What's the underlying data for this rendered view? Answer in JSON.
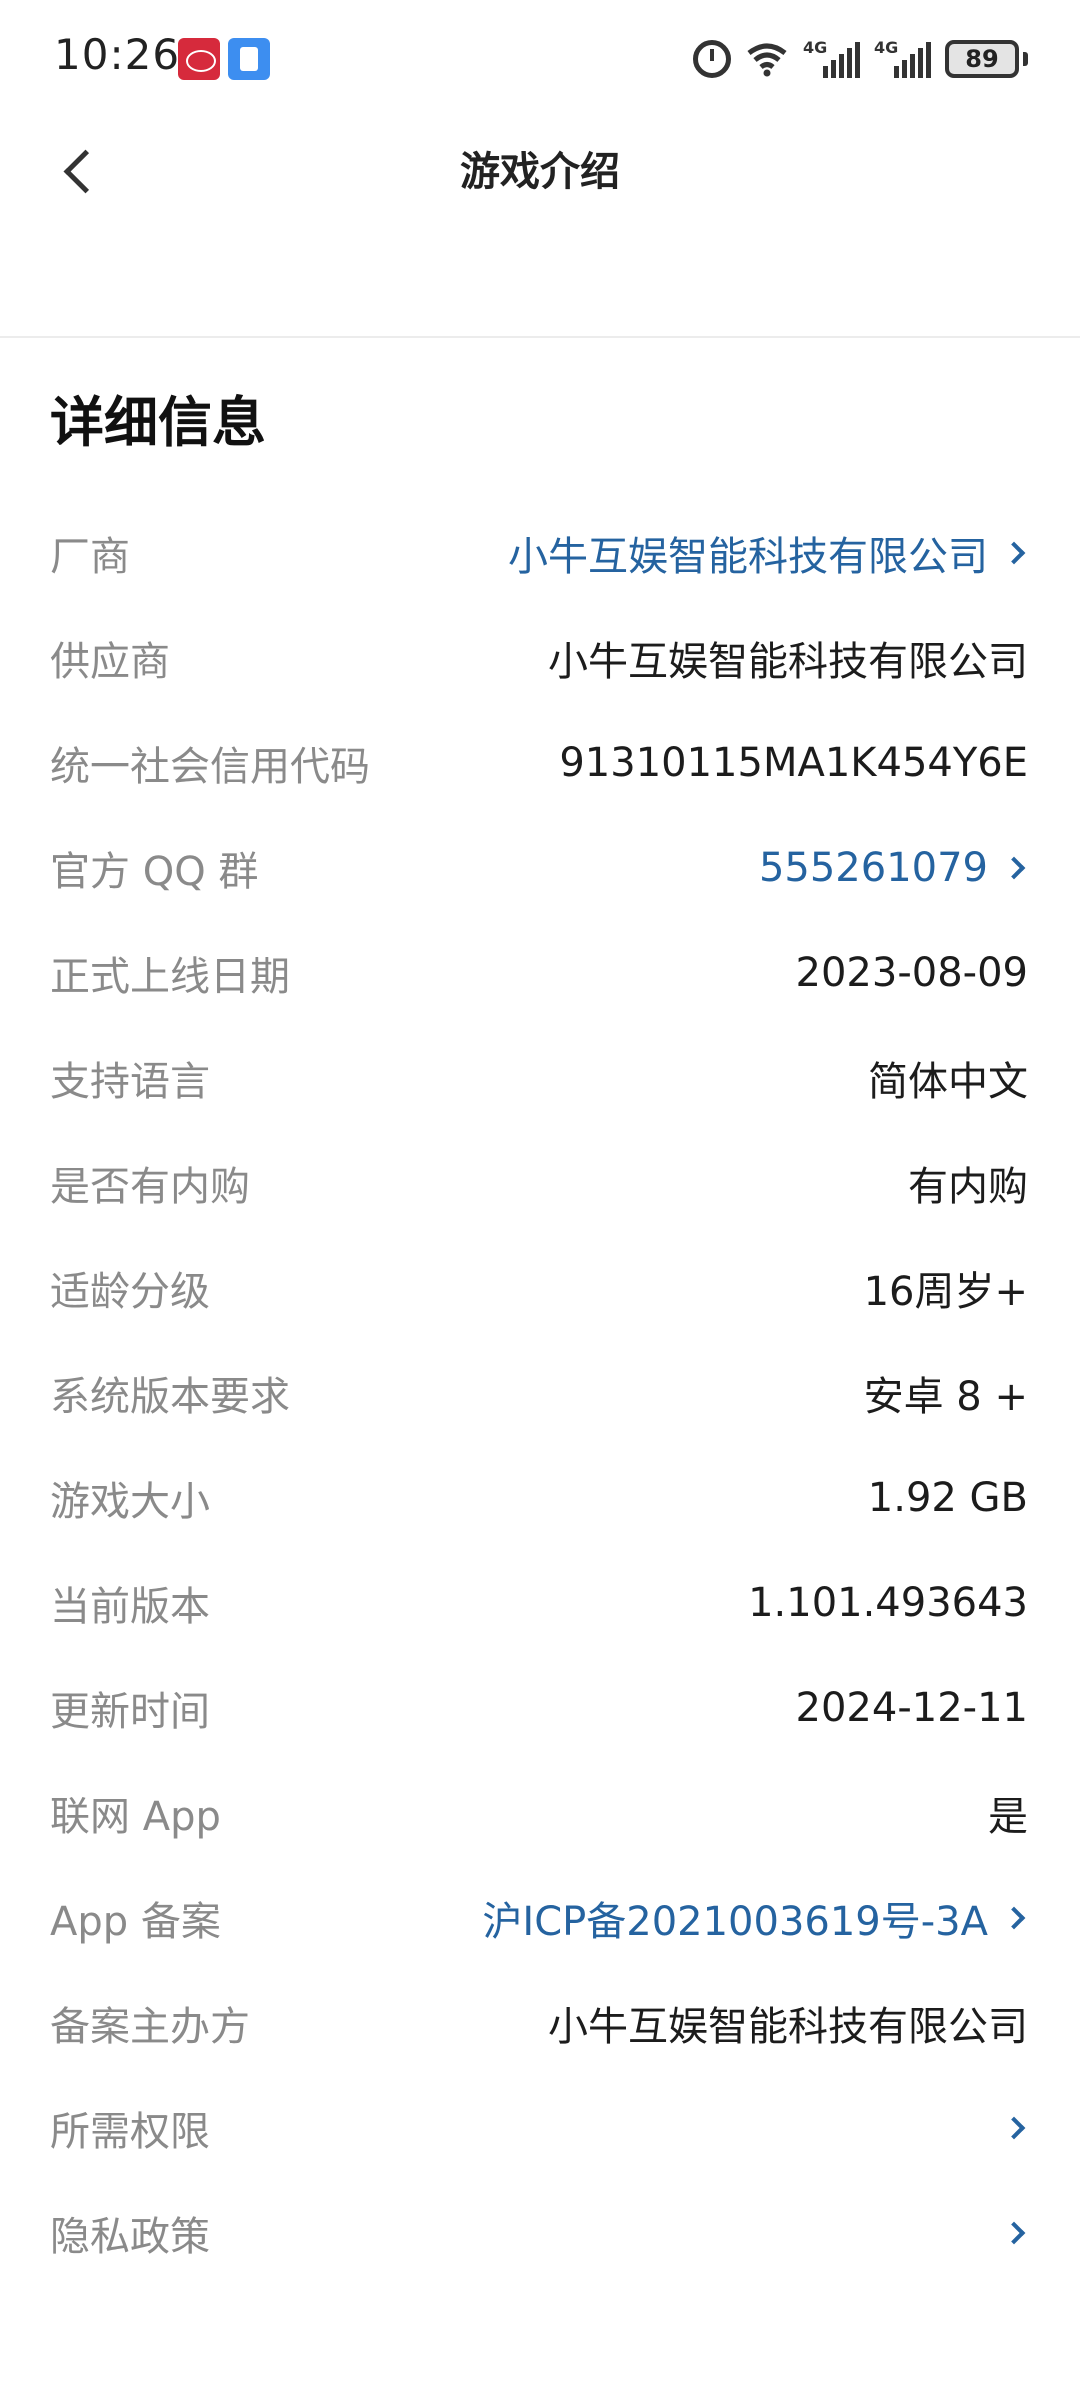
{
  "status_bar": {
    "time": "10:26",
    "battery": "89"
  },
  "header": {
    "title": "游戏介绍"
  },
  "section": {
    "title": "详细信息"
  },
  "rows": [
    {
      "label": "厂商",
      "value": "小牛互娱智能科技有限公司",
      "link": true
    },
    {
      "label": "供应商",
      "value": "小牛互娱智能科技有限公司",
      "link": false
    },
    {
      "label": "统一社会信用代码",
      "value": "91310115MA1K454Y6E",
      "link": false
    },
    {
      "label": "官方 QQ 群",
      "value": "555261079",
      "link": true
    },
    {
      "label": "正式上线日期",
      "value": "2023-08-09",
      "link": false
    },
    {
      "label": "支持语言",
      "value": "简体中文",
      "link": false
    },
    {
      "label": "是否有内购",
      "value": "有内购",
      "link": false
    },
    {
      "label": "适龄分级",
      "value": "16周岁+",
      "link": false
    },
    {
      "label": "系统版本要求",
      "value": "安卓 8 +",
      "link": false
    },
    {
      "label": "游戏大小",
      "value": "1.92 GB",
      "link": false
    },
    {
      "label": "当前版本",
      "value": "1.101.493643",
      "link": false
    },
    {
      "label": "更新时间",
      "value": "2024-12-11",
      "link": false
    },
    {
      "label": "联网 App",
      "value": "是",
      "link": false
    },
    {
      "label": "App 备案",
      "value": "沪ICP备2021003619号-3A",
      "link": true
    },
    {
      "label": "备案主办方",
      "value": "小牛互娱智能科技有限公司",
      "link": false
    },
    {
      "label": "所需权限",
      "value": "",
      "link": true
    },
    {
      "label": "隐私政策",
      "value": "",
      "link": true
    }
  ],
  "colors": {
    "link": "#2563a0",
    "label": "#8a8a8a",
    "value": "#1c1c1c"
  },
  "icons": [
    "back-icon",
    "alarm-icon",
    "wifi-icon",
    "signal-icon",
    "battery-icon",
    "chevron-right-icon"
  ]
}
